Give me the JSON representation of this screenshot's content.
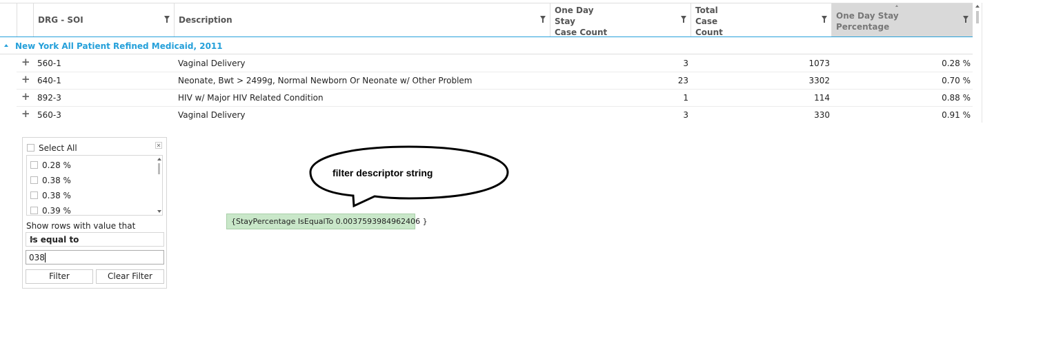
{
  "grid": {
    "columns": {
      "drg": "DRG - SOI",
      "description": "Description",
      "one_day": "One Day\nStay\nCase Count",
      "total": "Total\nCase\nCount",
      "pct": "One Day Stay\nPercentage"
    },
    "group_title": "New York All Patient Refined Medicaid, 2011",
    "expand_icon": "plus-icon",
    "rows": [
      {
        "drg": "560-1",
        "description": "Vaginal Delivery",
        "one_day": "3",
        "total": "1073",
        "pct": "0.28 %"
      },
      {
        "drg": "640-1",
        "description": "Neonate, Bwt > 2499g, Normal Newborn Or Neonate w/ Other Problem",
        "one_day": "23",
        "total": "3302",
        "pct": "0.70 %"
      },
      {
        "drg": "892-3",
        "description": "HIV w/ Major HIV Related Condition",
        "one_day": "1",
        "total": "114",
        "pct": "0.88 %"
      },
      {
        "drg": "560-3",
        "description": "Vaginal Delivery",
        "one_day": "3",
        "total": "330",
        "pct": "0.91 %"
      }
    ]
  },
  "filter_popup": {
    "select_all": "Select All",
    "values": [
      "0.28 %",
      "0.38 %",
      "0.38 %",
      "0.39 %"
    ],
    "show_rows_label": "Show rows with value that",
    "operator": "Is equal to",
    "input_value": "038",
    "filter_button": "Filter",
    "clear_button": "Clear Filter"
  },
  "annotation": {
    "bubble_text": "filter descriptor string",
    "descriptor": "{StayPercentage IsEqualTo 0.0037593984962406 }"
  },
  "colors": {
    "accent": "#25a0da",
    "sorted_header": "#d9d9d9",
    "descriptor_bg": "#c9e7c9"
  }
}
